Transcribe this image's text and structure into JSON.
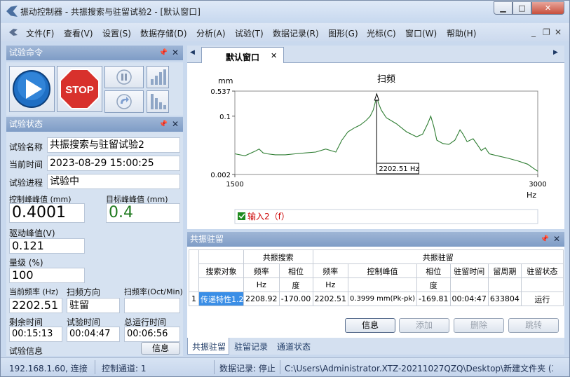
{
  "window": {
    "title": "振动控制器 - 共振搜索与驻留试验2 - [默认窗口]",
    "min_label": "▁",
    "max_label": "□",
    "close_label": "✕"
  },
  "menu": {
    "items": [
      "文件(F)",
      "查看(V)",
      "设置(S)",
      "数据存储(D)",
      "分析(A)",
      "试验(T)",
      "数据记录(R)",
      "图形(G)",
      "光标(C)",
      "窗口(W)",
      "帮助(H)"
    ],
    "mdi_min": "_",
    "mdi_restore": "❐",
    "mdi_close": "✕"
  },
  "cmd_panel": {
    "title": "试验命令",
    "stop_label": "STOP"
  },
  "status_panel": {
    "title": "试验状态",
    "name_label": "试验名称",
    "name_value": "共振搜索与驻留试验2",
    "time_label": "当前时间",
    "time_value": "2023-08-29 15:00:25",
    "progress_label": "试验进程",
    "progress_value": "试验中",
    "ctrl_label": "控制峰峰值 (mm)",
    "ctrl_value": "0.4001",
    "target_label": "目标峰峰值 (mm)",
    "target_value": "0.4",
    "drive_label": "驱动峰值(V)",
    "drive_value": "0.121",
    "level_label": "量级 (%)",
    "level_value": "100",
    "freq_label": "当前频率 (Hz)",
    "freq_value": "2202.51",
    "dir_label": "扫频方向",
    "dir_value": "驻留",
    "rate_label": "扫频率(Oct/Min)",
    "rate_value": "",
    "remain_label": "剩余时间",
    "remain_value": "00:15:13",
    "elapsed_label": "试验时间",
    "elapsed_value": "00:04:47",
    "total_label": "总运行时间",
    "total_value": "00:06:56",
    "info_label": "试验信息",
    "info_button": "信息"
  },
  "doc_tab": {
    "label": "默认窗口",
    "close": "✕",
    "left_arrow": "◀",
    "right_arrow": "▶"
  },
  "chart_data": {
    "type": "line",
    "title": "扫频",
    "ylabel": "mm",
    "xlabel": "Hz",
    "x_scale": "linear",
    "y_scale": "log",
    "xlim": [
      1500,
      3000
    ],
    "ylim": [
      0.002,
      0.537
    ],
    "x_ticks": [
      "1500",
      "3000"
    ],
    "y_ticks": [
      "0.537",
      "0.1",
      "0.002"
    ],
    "cursor_label": "2202.51 Hz",
    "cursor_x": 2202.51,
    "line_color": "#2e7d32",
    "legend": {
      "label": "输入2（f）",
      "color": "#cc0000"
    },
    "series": [
      {
        "name": "输入2（f）",
        "x": [
          1500,
          1550,
          1600,
          1620,
          1640,
          1660,
          1700,
          1750,
          1800,
          1850,
          1900,
          1950,
          2000,
          2030,
          2060,
          2090,
          2120,
          2150,
          2170,
          2185,
          2195,
          2202,
          2210,
          2225,
          2250,
          2300,
          2350,
          2400,
          2430,
          2455,
          2470,
          2485,
          2500,
          2530,
          2560,
          2590,
          2615,
          2630,
          2650,
          2680,
          2700,
          2720,
          2740,
          2760,
          2800,
          2850,
          2900,
          2950,
          2980,
          3000
        ],
        "y": [
          0.008,
          0.007,
          0.0095,
          0.011,
          0.0085,
          0.008,
          0.0075,
          0.0075,
          0.008,
          0.0085,
          0.009,
          0.011,
          0.009,
          0.02,
          0.035,
          0.045,
          0.055,
          0.075,
          0.1,
          0.15,
          0.25,
          0.45,
          0.25,
          0.15,
          0.09,
          0.06,
          0.035,
          0.025,
          0.03,
          0.06,
          0.1,
          0.05,
          0.02,
          0.016,
          0.015,
          0.02,
          0.04,
          0.03,
          0.018,
          0.022,
          0.015,
          0.01,
          0.012,
          0.008,
          0.007,
          0.006,
          0.005,
          0.004,
          0.003,
          0.0025
        ]
      }
    ]
  },
  "resonance_panel": {
    "title": "共振驻留",
    "group_search": "共振搜索",
    "group_dwell": "共振驻留",
    "headers": [
      "搜索对象",
      "频率",
      "相位",
      "频率",
      "控制峰值",
      "相位",
      "驻留时间",
      "留周期",
      "驻留状态"
    ],
    "units": [
      "",
      "Hz",
      "度",
      "Hz",
      "",
      "度",
      "",
      "",
      ""
    ],
    "rows": [
      [
        "1",
        "传递特性1.2",
        "2208.92",
        "-170.00",
        "2202.51",
        "0.3999 mm(Pk-pk)",
        "-169.81",
        "00:04:47",
        "633804",
        "运行"
      ]
    ],
    "buttons": [
      "信息",
      "添加",
      "删除",
      "跳转"
    ]
  },
  "bottom_tabs": [
    "共振驻留",
    "驻留记录",
    "通道状态"
  ],
  "statusbar": {
    "connection": "192.168.1.60, 连接",
    "channel": "控制通道: 1",
    "record": "数据记录: 停止",
    "path": "C:\\Users\\Administrator.XTZ-20211027QZQ\\Desktop\\新建文件夹 (3"
  },
  "colors": {
    "accent": "#7e9cc6",
    "frame": "#c9d9ee",
    "target_green": "#1f7a1f",
    "legend_red": "#cc0000"
  }
}
